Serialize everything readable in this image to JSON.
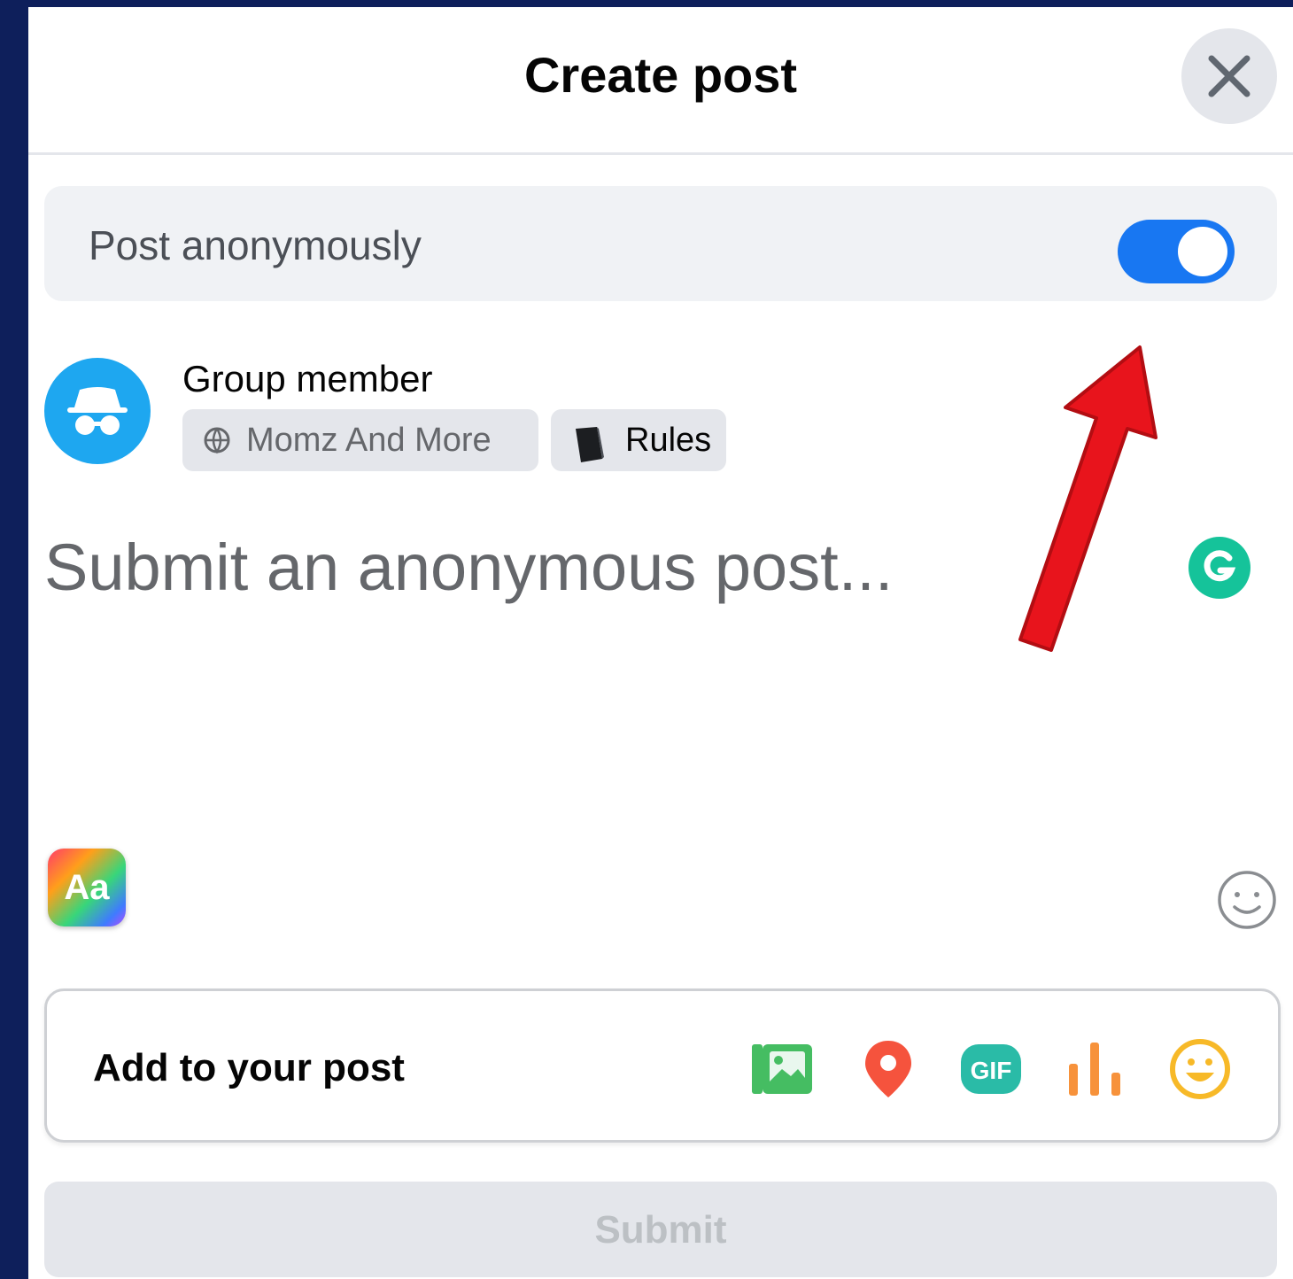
{
  "dialog": {
    "title": "Create post",
    "close_icon": "close-icon"
  },
  "anonymous": {
    "label": "Post anonymously",
    "enabled": true,
    "toggle_color": "#1877f2"
  },
  "author": {
    "name": "Group member",
    "avatar_icon": "incognito-icon",
    "group_chip": {
      "icon": "globe-icon",
      "label": "Momz And More"
    },
    "rules_chip": {
      "icon": "book-icon",
      "label": "Rules"
    }
  },
  "composer": {
    "placeholder": "Submit an anonymous post..."
  },
  "formatting": {
    "background_button_label": "Aa"
  },
  "add_to_post": {
    "label": "Add to your post",
    "icons": [
      "photo-icon",
      "location-pin-icon",
      "gif-icon",
      "poll-icon",
      "feeling-icon"
    ]
  },
  "submit": {
    "label": "Submit",
    "enabled": false
  },
  "colors": {
    "background": "#0e1f5b",
    "annotation_arrow": "#e8141c",
    "primary": "#1877f2"
  }
}
